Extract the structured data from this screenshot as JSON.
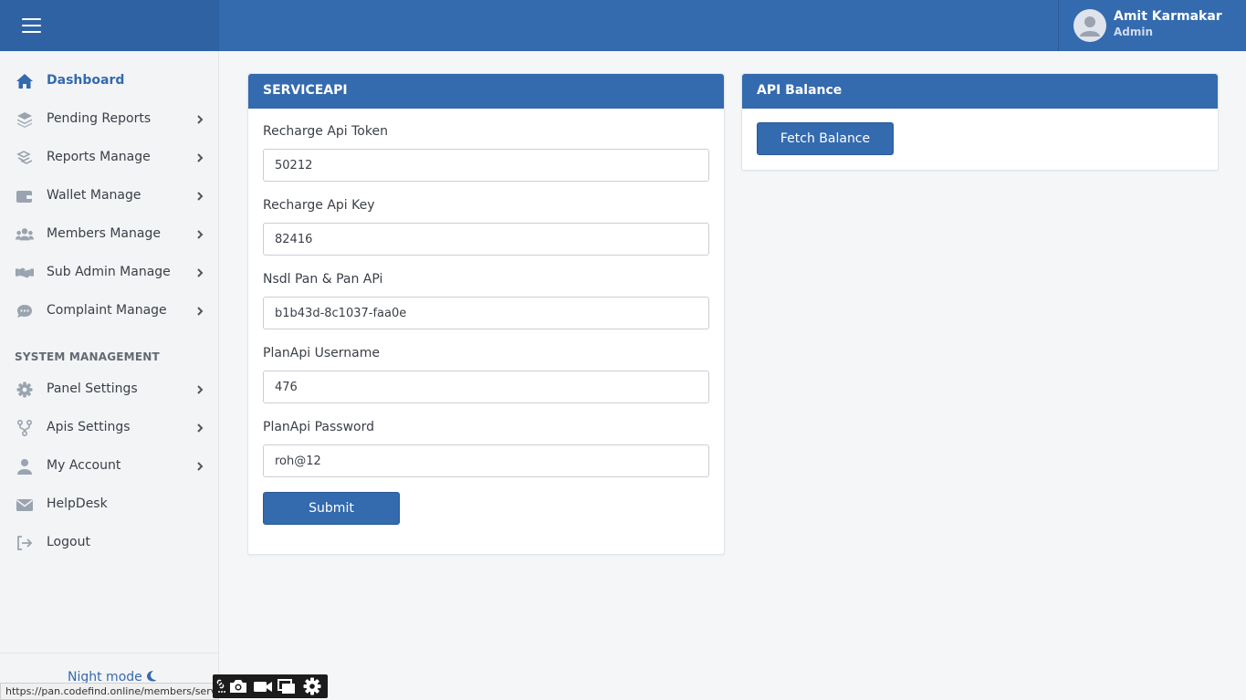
{
  "header": {
    "menu_icon": "hamburger-icon",
    "user": {
      "name": "Amit Karmakar",
      "role": "Admin",
      "avatar_icon": "user-avatar-icon"
    }
  },
  "sidebar": {
    "items": [
      {
        "label": "Dashboard",
        "icon": "home-icon",
        "active": true,
        "has_submenu": false
      },
      {
        "label": "Pending Reports",
        "icon": "layers-icon",
        "has_submenu": true
      },
      {
        "label": "Reports Manage",
        "icon": "stack-icon",
        "has_submenu": true
      },
      {
        "label": "Wallet Manage",
        "icon": "wallet-icon",
        "has_submenu": true
      },
      {
        "label": "Members Manage",
        "icon": "users-icon",
        "has_submenu": true
      },
      {
        "label": "Sub Admin Manage",
        "icon": "handshake-icon",
        "has_submenu": true
      },
      {
        "label": "Complaint Manage",
        "icon": "chat-icon",
        "has_submenu": true
      }
    ],
    "section_title": "SYSTEM MANAGEMENT",
    "system_items": [
      {
        "label": "Panel Settings",
        "icon": "gear-icon",
        "has_submenu": true
      },
      {
        "label": "Apis Settings",
        "icon": "fork-icon",
        "has_submenu": true
      },
      {
        "label": "My Account",
        "icon": "user-icon",
        "has_submenu": true
      },
      {
        "label": "HelpDesk",
        "icon": "envelope-icon",
        "has_submenu": false
      },
      {
        "label": "Logout",
        "icon": "logout-icon",
        "has_submenu": false
      }
    ],
    "night_mode": {
      "label": "Night mode",
      "icon": "moon-icon"
    }
  },
  "service_card": {
    "title": "SERVICEAPI",
    "fields": [
      {
        "label": "Recharge Api Token",
        "value": "50212"
      },
      {
        "label": "Recharge Api Key",
        "value": "82416"
      },
      {
        "label": "Nsdl Pan & Pan APi",
        "value": "b1b43d-8c1037-faa0e"
      },
      {
        "label": "PlanApi Username",
        "value": "476"
      },
      {
        "label": "PlanApi Password",
        "value": "roh@12"
      }
    ],
    "submit_label": "Submit"
  },
  "balance_card": {
    "title": "API Balance",
    "fetch_label": "Fetch Balance"
  },
  "status_bar": {
    "url": "https://pan.codefind.online/members/servic"
  },
  "capture_toolbar": {
    "icons": [
      "link-icon",
      "camera-icon",
      "video-camera-icon",
      "window-icon",
      "gear-icon"
    ]
  },
  "colors": {
    "primary": "#346aae",
    "header_dark": "#2f62a3",
    "sidebar_bg": "#f3f4f6",
    "page_bg": "#f5f6f8",
    "icon_gray": "#9aa3b0"
  }
}
